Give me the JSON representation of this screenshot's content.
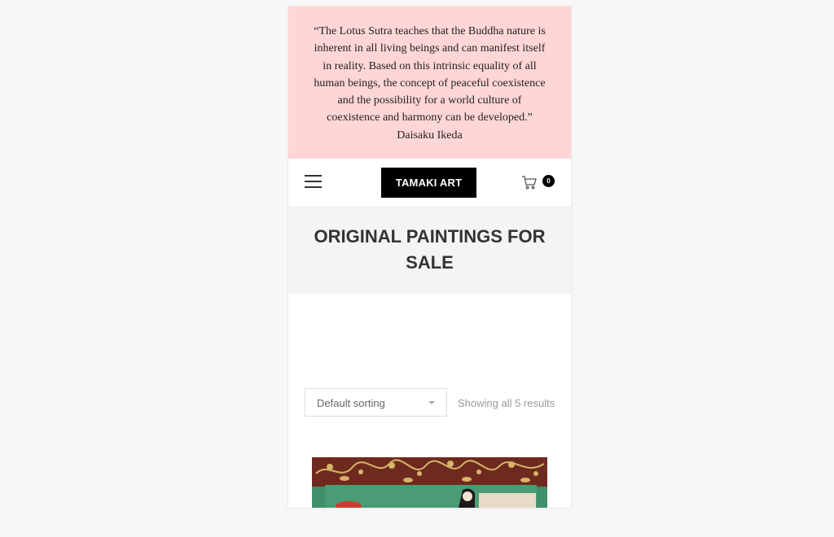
{
  "banner": {
    "quote": "“The Lotus Sutra teaches that the Buddha nature is inherent in all living beings and can manifest itself in reality. Based on this intrinsic equality of all human beings, the concept of peaceful coexistence and the possibility for a world culture of coexistence and harmony can be developed.” Daisaku Ikeda",
    "background": "#ffd6d6"
  },
  "header": {
    "menu_icon": "hamburger-menu-icon",
    "logo_text": "TAMAKI ART",
    "cart_icon": "shopping-cart-icon",
    "cart_count": "0"
  },
  "page": {
    "title": "ORIGINAL PAINTINGS FOR SALE"
  },
  "shop": {
    "sort_selected": "Default sorting",
    "result_count": "Showing all 5 results"
  },
  "products": [
    {
      "image_description": "painting with gold vines on dark red background and green area"
    }
  ]
}
